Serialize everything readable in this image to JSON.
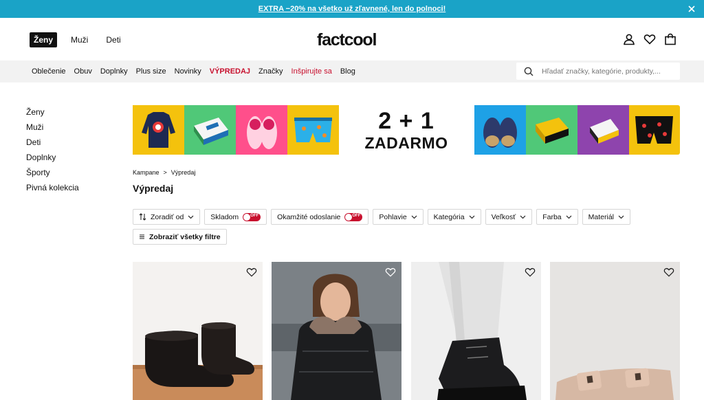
{
  "promo": {
    "text": "EXTRA −20% na všetko už zľavnené, len do polnoci!"
  },
  "header": {
    "genders": [
      {
        "label": "Ženy",
        "active": true
      },
      {
        "label": "Muži",
        "active": false
      },
      {
        "label": "Deti",
        "active": false
      }
    ],
    "logo": "factcool",
    "icons": [
      "user-icon",
      "heart-icon",
      "bag-icon"
    ]
  },
  "catnav": {
    "items": [
      "Oblečenie",
      "Obuv",
      "Doplnky",
      "Plus size",
      "Novinky",
      "VÝPREDAJ",
      "Značky",
      "Inšpirujte sa",
      "Blog"
    ],
    "search_placeholder": "Hľadať značky, kategórie, produkty,..."
  },
  "sidebar": {
    "items": [
      "Ženy",
      "Muži",
      "Deti",
      "Doplnky",
      "Športy",
      "Pivná kolekcia"
    ]
  },
  "banner": {
    "headline": "2 + 1",
    "subline": "ZADARMO"
  },
  "breadcrumb": {
    "items": [
      "Kampane",
      "Výpredaj"
    ],
    "separator": ">"
  },
  "page_title": "Výpredaj",
  "filters": {
    "sort_label": "Zoradiť od",
    "stock_label": "Skladom",
    "immediate_label": "Okamžité odoslanie",
    "toggle_off": "OFF",
    "dropdowns": [
      "Pohlavie",
      "Kategória",
      "Veľkosť",
      "Farba",
      "Materiál"
    ],
    "show_all": "Zobraziť všetky filtre"
  },
  "colors": {
    "promo_bg": "#1aa3c7",
    "sale_red": "#c8102e",
    "nav_bg": "#f2f2f2"
  }
}
